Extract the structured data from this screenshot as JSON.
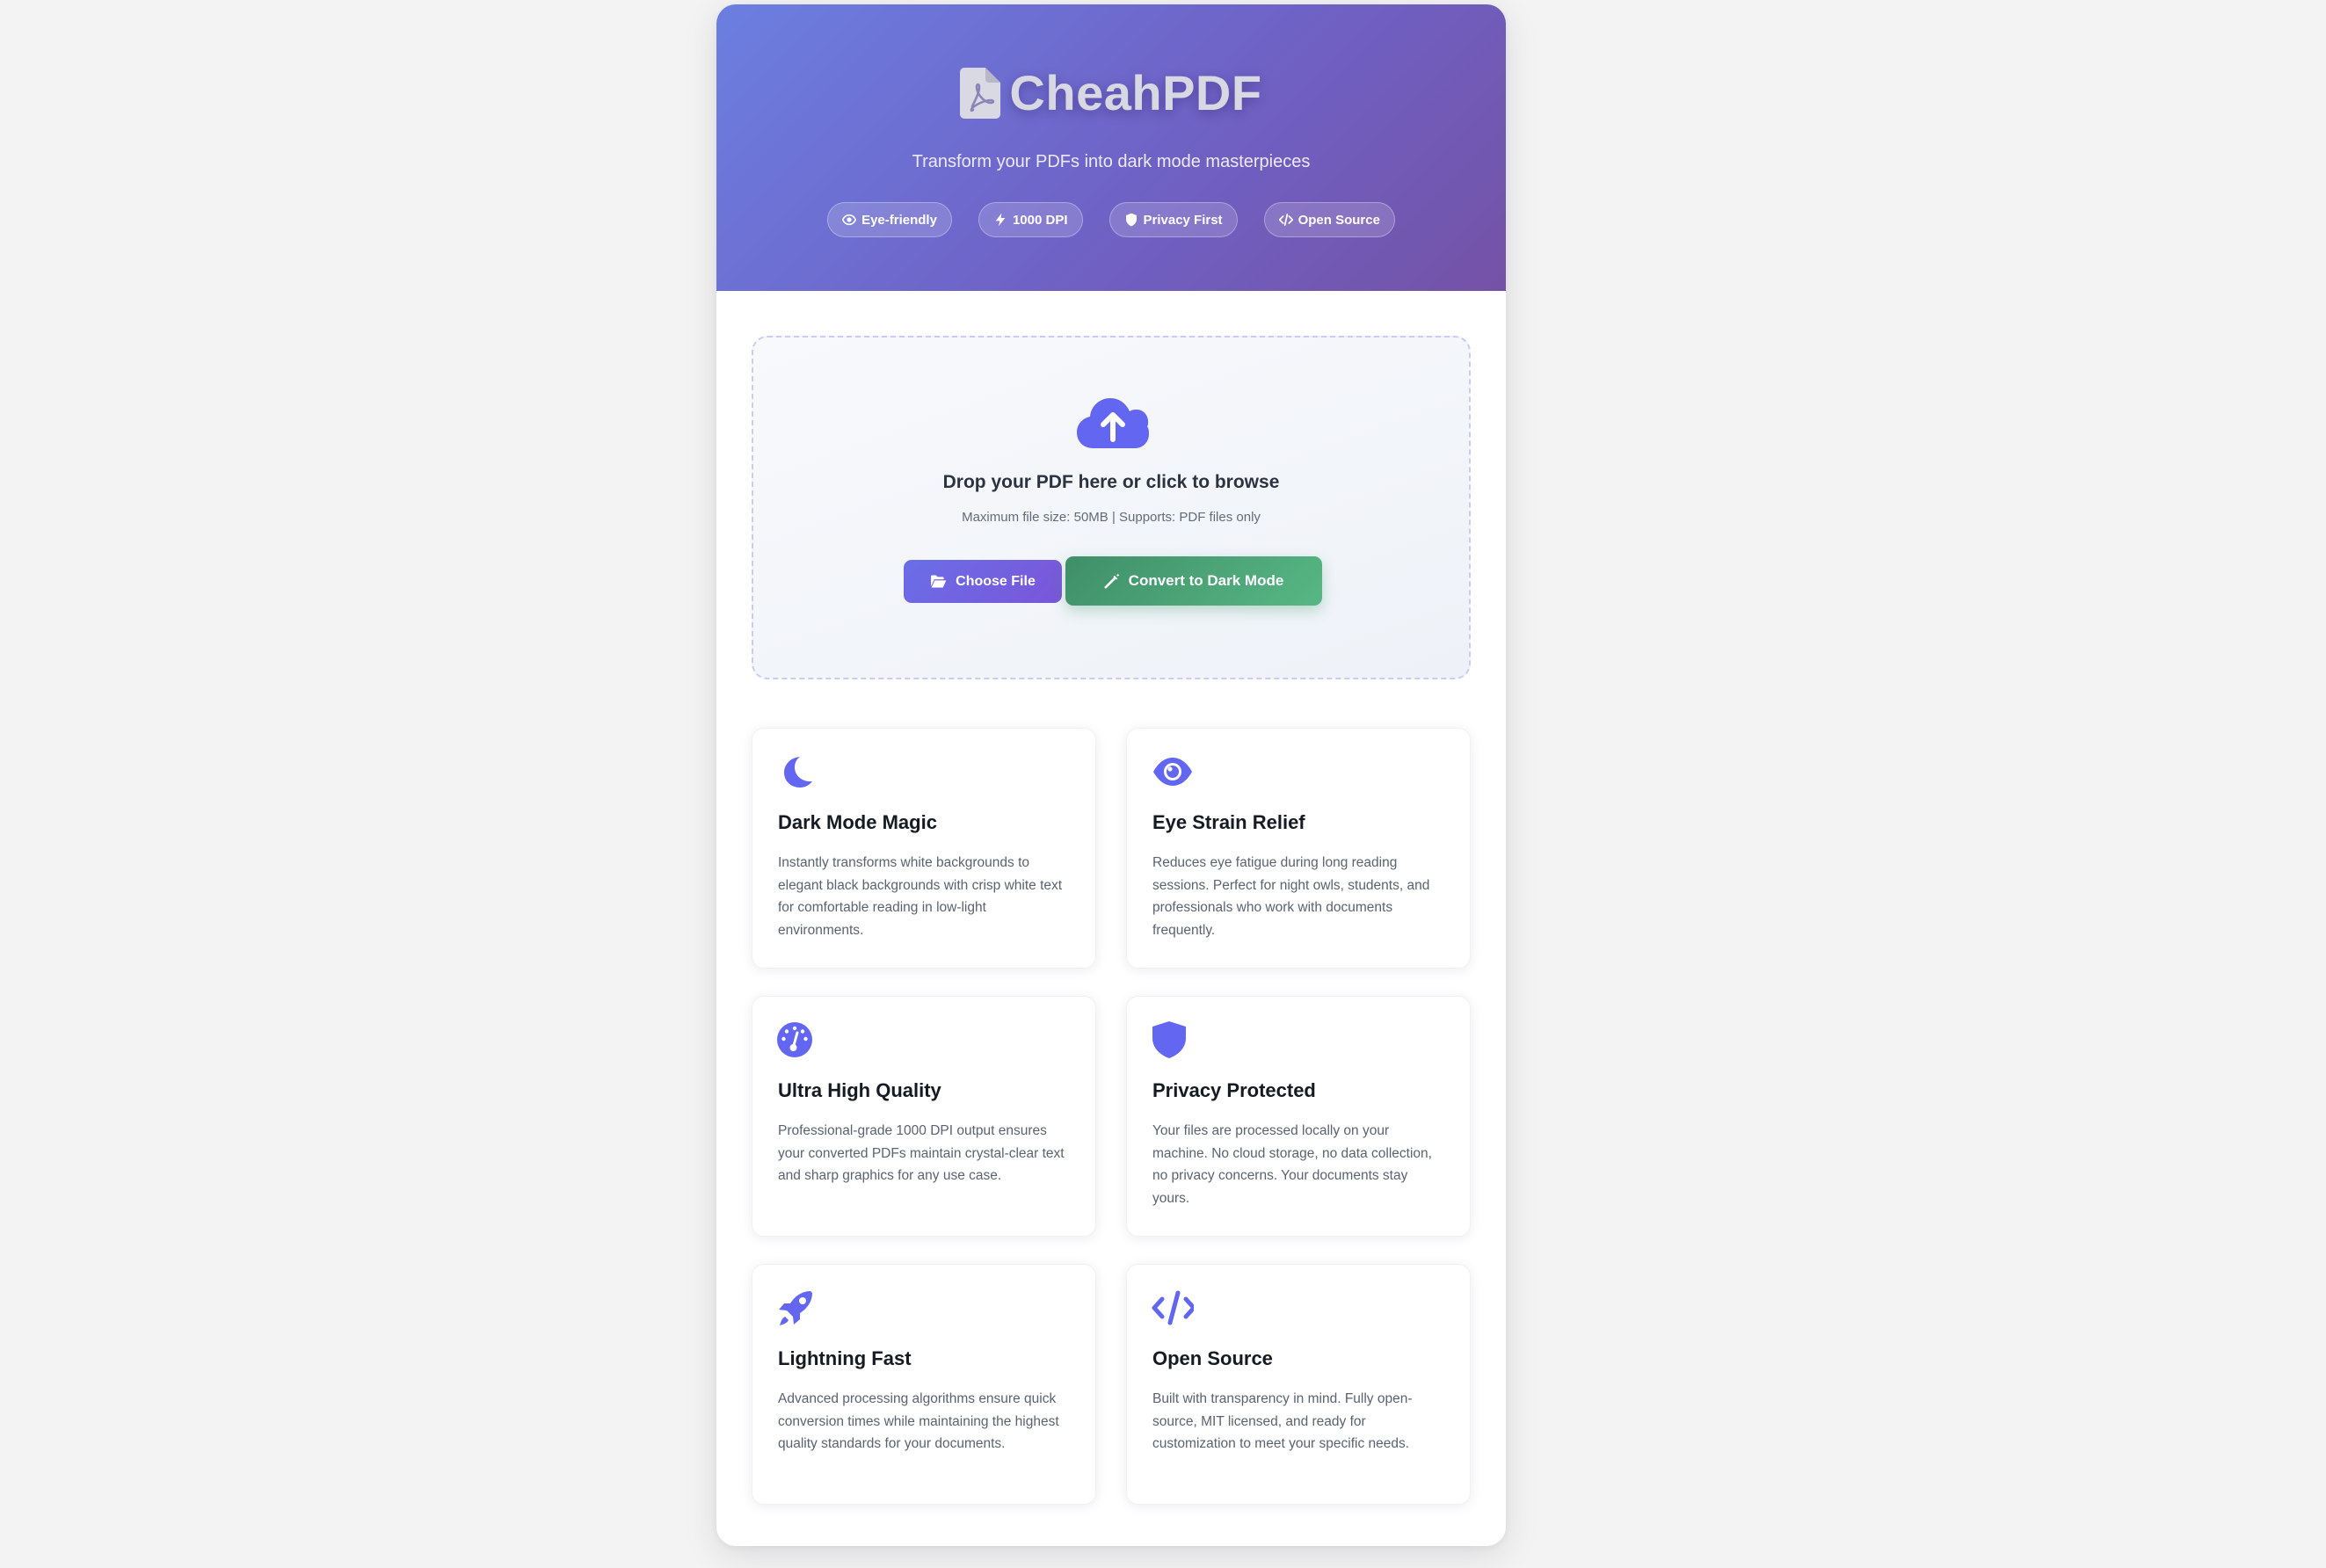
{
  "header": {
    "title": "CheahPDF",
    "tagline": "Transform your PDFs into dark mode masterpieces",
    "badges": [
      {
        "label": "Eye-friendly",
        "icon": "eye-icon"
      },
      {
        "label": "1000 DPI",
        "icon": "bolt-icon"
      },
      {
        "label": "Privacy First",
        "icon": "shield-icon"
      },
      {
        "label": "Open Source",
        "icon": "code-icon"
      }
    ]
  },
  "upload": {
    "title": "Drop your PDF here or click to browse",
    "hint": "Maximum file size: 50MB | Supports: PDF files only",
    "choose_label": "Choose File",
    "convert_label": "Convert to Dark Mode"
  },
  "features": [
    {
      "icon": "moon-icon",
      "title": "Dark Mode Magic",
      "desc": "Instantly transforms white backgrounds to elegant black backgrounds with crisp white text for comfortable reading in low-light environments."
    },
    {
      "icon": "eye-icon",
      "title": "Eye Strain Relief",
      "desc": "Reduces eye fatigue during long reading sessions. Perfect for night owls, students, and professionals who work with documents frequently."
    },
    {
      "icon": "gauge-icon",
      "title": "Ultra High Quality",
      "desc": "Professional-grade 1000 DPI output ensures your converted PDFs maintain crystal-clear text and sharp graphics for any use case."
    },
    {
      "icon": "shield-icon",
      "title": "Privacy Protected",
      "desc": "Your files are processed locally on your machine. No cloud storage, no data collection, no privacy concerns. Your documents stay yours."
    },
    {
      "icon": "rocket-icon",
      "title": "Lightning Fast",
      "desc": "Advanced processing algorithms ensure quick conversion times while maintaining the highest quality standards for your documents."
    },
    {
      "icon": "code-icon",
      "title": "Open Source",
      "desc": "Built with transparency in mind. Fully open-source, MIT licensed, and ready for customization to meet your specific needs."
    }
  ],
  "colors": {
    "accent": "#6366f1",
    "header_gradient_start": "#6b7fe0",
    "header_gradient_end": "#7452a6",
    "convert_button": "#4caf7d",
    "choose_button": "#6a64e2"
  }
}
